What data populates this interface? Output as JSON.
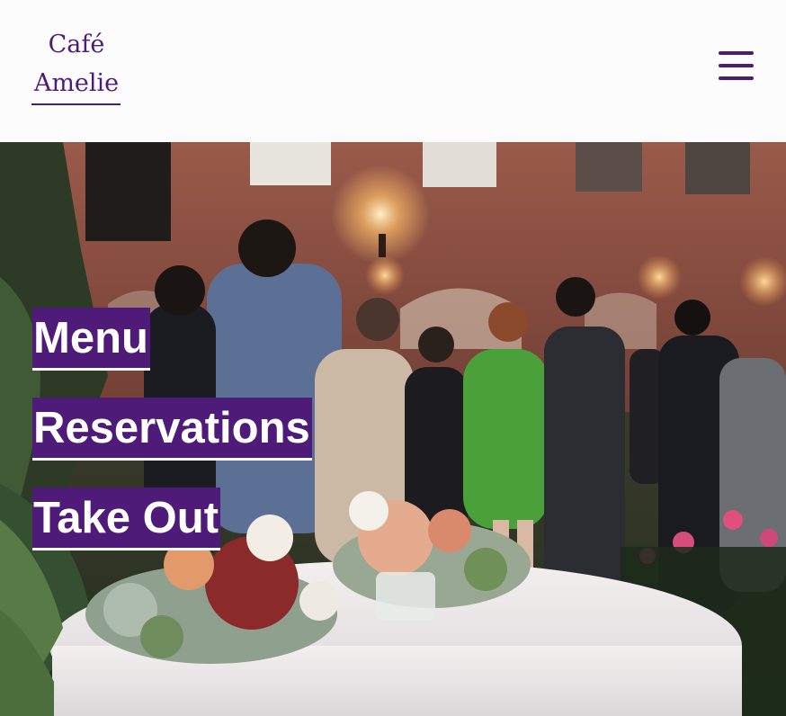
{
  "header": {
    "logo_line1": "Café",
    "logo_line2": "Amelie",
    "menu_icon": "hamburger-menu-icon"
  },
  "hero": {
    "image": "outdoor-courtyard-party-photo",
    "links": [
      {
        "label": "Menu"
      },
      {
        "label": "Reservations"
      },
      {
        "label": "Take Out"
      }
    ]
  },
  "colors": {
    "brand_purple": "#4e1b78",
    "header_bg": "#fdfcfc",
    "link_text": "#ffffff"
  }
}
